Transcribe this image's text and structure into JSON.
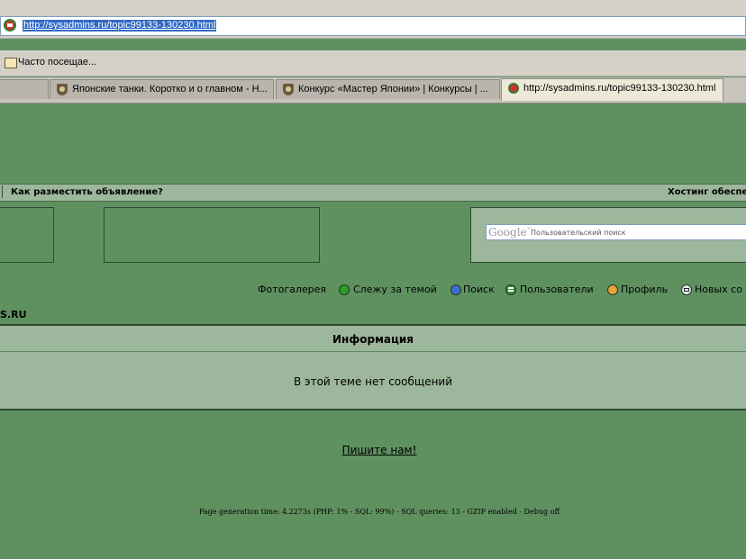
{
  "browser": {
    "address_url": "http://sysadmins.ru/topic99133-130230.html",
    "bookmark": "Часто посещае...",
    "tabs": [
      {
        "label": "Японские танки. Коротко и о главном - Н..."
      },
      {
        "label": "Конкурс «Мастер Японии» | Конкурсы | ..."
      },
      {
        "label": "http://sysadmins.ru/topic99133-130230.html"
      }
    ]
  },
  "page": {
    "ad_bar_left": "Как разместить объявление?",
    "ad_bar_right": "Хостинг обеспе",
    "search": {
      "brand": "Google",
      "brand_sup": "™",
      "placeholder": "Пользовательский поиск"
    },
    "nav": [
      {
        "label": "Фотогалерея",
        "icon": "none"
      },
      {
        "label": "Слежу за темой",
        "icon": "watch-icon"
      },
      {
        "label": "Поиск",
        "icon": "search-icon"
      },
      {
        "label": "Пользователи",
        "icon": "users-icon"
      },
      {
        "label": "Профиль",
        "icon": "profile-icon"
      },
      {
        "label": "Новых со",
        "icon": "messages-icon"
      }
    ],
    "site_name": "S.RU",
    "info_title": "Информация",
    "info_message": "В этой теме нет сообщений",
    "contact_link": "Пишите нам!",
    "footer_stats": "Page generation time: 4.2273s (PHP: 1% - SQL: 99%) - SQL queries: 13 - GZIP enabled - Debug off"
  },
  "colors": {
    "page_bg": "#5f9160",
    "panel_bg": "#9cb79c",
    "border": "#2f4a2f"
  }
}
